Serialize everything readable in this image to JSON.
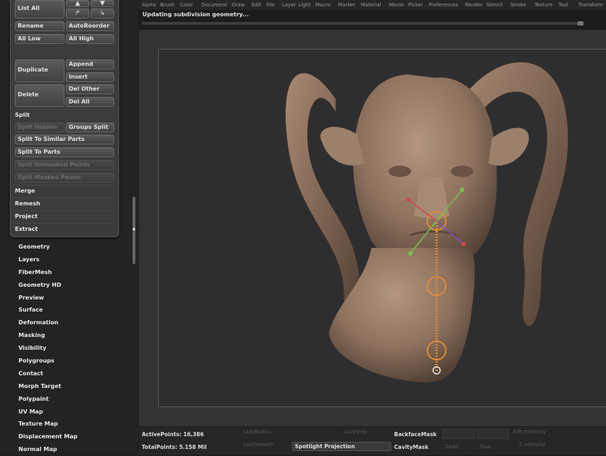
{
  "subtool": {
    "list_all": "List All",
    "rename": "Rename",
    "auto_reorder": "AutoReorder",
    "all_low": "All Low",
    "all_high": "All High",
    "duplicate": "Duplicate",
    "append": "Append",
    "insert": "Insert",
    "delete": "Delete",
    "del_other": "Del Other",
    "del_all": "Del All",
    "split": "Split",
    "split_hidden": "Split Hidden",
    "groups_split": "Groups Split",
    "split_similar": "Split To Similar Parts",
    "split_parts": "Split To Parts",
    "split_unmasked": "Split Unmasked Points",
    "split_masked": "Split Masked Points",
    "merge": "Merge",
    "remesh": "Remesh",
    "project": "Project",
    "extract": "Extract"
  },
  "palettes": [
    "Geometry",
    "Layers",
    "FiberMesh",
    "Geometry HD",
    "Preview",
    "Surface",
    "Deformation",
    "Masking",
    "Visibility",
    "Polygroups",
    "Contact",
    "Morph Target",
    "Polypaint",
    "UV Map",
    "Texture Map",
    "Displacement Map",
    "Normal Map"
  ],
  "menu": [
    "Alpha",
    "Brush",
    "Color",
    "Document",
    "Draw",
    "Edit",
    "File",
    "Layer",
    "Light",
    "Macro",
    "Marker",
    "Material",
    "Movie",
    "Picker",
    "Preferences",
    "Render",
    "Stencil",
    "Stroke",
    "Texture",
    "Tool",
    "Transform"
  ],
  "status": {
    "text": "Updating subdivision geometry...",
    "progress": 0.99
  },
  "bottom": {
    "active_points": "ActivePoints: 16,386",
    "total_points": "TotalPoints: 5.158 Mil",
    "lazy_radius": "LazyRadius",
    "lazy_smooth": "LazySmooth",
    "lazy_step": "LazyStep",
    "backface_mask": "BackfaceMask",
    "spotlight_projection": "Spotlight Projection",
    "cavity_mask": "CavityMask",
    "edit_intensity": "Edit Intensity",
    "z_intensity": "Z Intensity",
    "zadd": "Zadd",
    "zsub": "Zsub"
  },
  "colors": {
    "skin": "#9a7d67",
    "gizmo": "#e08a3a",
    "panel": "#3b3b3b"
  }
}
